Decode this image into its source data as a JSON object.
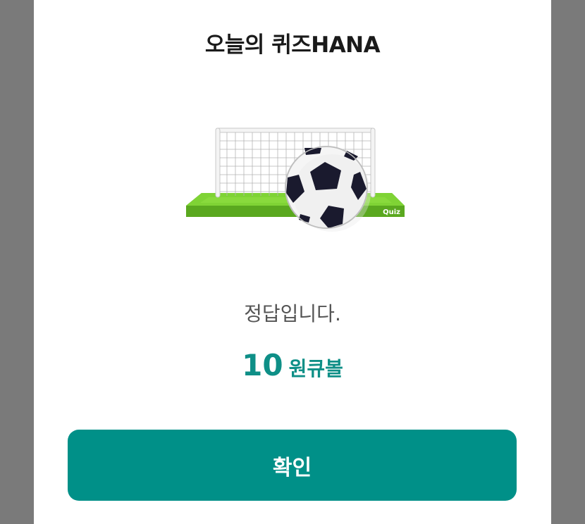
{
  "dialog": {
    "title": "오늘의 퀴즈HANA",
    "image_badge": "Quiz",
    "result_message": "정답입니다.",
    "reward_amount": "10",
    "reward_unit": "원큐볼",
    "confirm_label": "확인"
  },
  "colors": {
    "accent": "#009088",
    "reward_text": "#0e8f87",
    "overlay": "#7a7a7a",
    "field_green": "#6dc02a"
  },
  "icons": [
    "soccer-goal-icon",
    "soccer-ball-icon"
  ]
}
